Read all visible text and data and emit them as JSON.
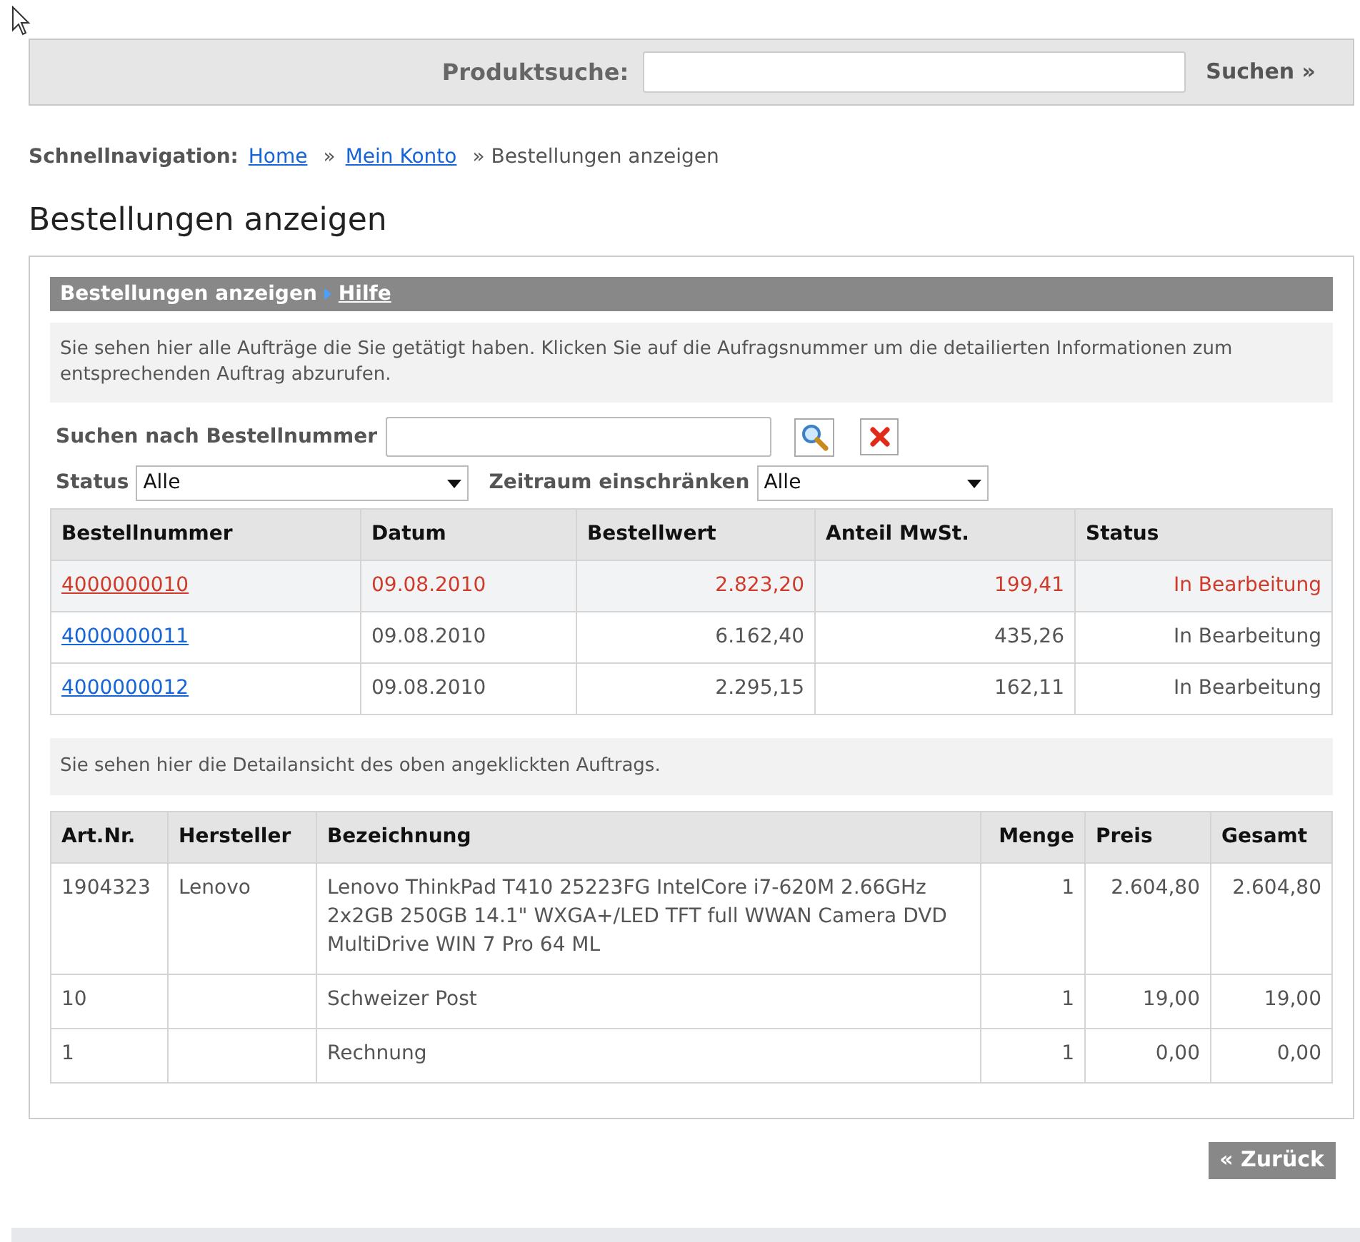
{
  "search_bar": {
    "label": "Produktsuche:",
    "button": "Suchen",
    "button_arrow": "»"
  },
  "breadcrumb": {
    "label": "Schnellnavigation:",
    "items": [
      {
        "text": "Home",
        "kind": "link"
      },
      {
        "text": "» ",
        "kind": "separator"
      },
      {
        "text": "Mein Konto",
        "kind": "link"
      },
      {
        "text": "» Bestellungen anzeigen",
        "kind": "current"
      }
    ]
  },
  "page_title": "Bestellungen anzeigen",
  "panel": {
    "header": "Bestellungen anzeigen",
    "help_link": "Hilfe",
    "intro": "Sie sehen hier alle Aufträge die Sie getätigt haben. Klicken Sie auf die Aufragsnummer um die detailierten Informationen zum entsprechenden Auftrag abzurufen.",
    "order_search": {
      "label": "Suchen nach Bestellnummer"
    },
    "filters": [
      {
        "label": "Status",
        "value": "Alle"
      },
      {
        "label": "Zeitraum einschränken",
        "value": "Alle"
      }
    ],
    "orders": {
      "columns": [
        "Bestellnummer",
        "Datum",
        "Bestellwert",
        "Anteil MwSt.",
        "Status"
      ],
      "rows": [
        {
          "number": "4000000010",
          "date": "09.08.2010",
          "value": "2.823,20",
          "vat": "199,41",
          "status": "In Bearbeitung",
          "selected": true
        },
        {
          "number": "4000000011",
          "date": "09.08.2010",
          "value": "6.162,40",
          "vat": "435,26",
          "status": "In Bearbeitung",
          "selected": false
        },
        {
          "number": "4000000012",
          "date": "09.08.2010",
          "value": "2.295,15",
          "vat": "162,11",
          "status": "In Bearbeitung",
          "selected": false
        }
      ]
    },
    "detail_intro": "Sie sehen hier die Detailansicht des oben angeklickten Auftrags.",
    "details": {
      "columns": [
        "Art.Nr.",
        "Hersteller",
        "Bezeichnung",
        "Menge",
        "Preis",
        "Gesamt"
      ],
      "rows": [
        {
          "article": "1904323",
          "maker": "Lenovo",
          "description": "Lenovo ThinkPad T410 25223FG IntelCore i7-620M 2.66GHz 2x2GB 250GB 14.1\" WXGA+/LED TFT full WWAN Camera DVD MultiDrive WIN 7 Pro 64 ML",
          "quantity": "1",
          "price": "2.604,80",
          "total": "2.604,80"
        },
        {
          "article": "10",
          "description": "Schweizer Post",
          "quantity": "1",
          "price": "19,00",
          "total": "19,00"
        },
        {
          "article": "1",
          "description": "Rechnung",
          "quantity": "1",
          "price": "0,00",
          "total": "0,00"
        }
      ]
    }
  },
  "back_button": "« Zurück"
}
